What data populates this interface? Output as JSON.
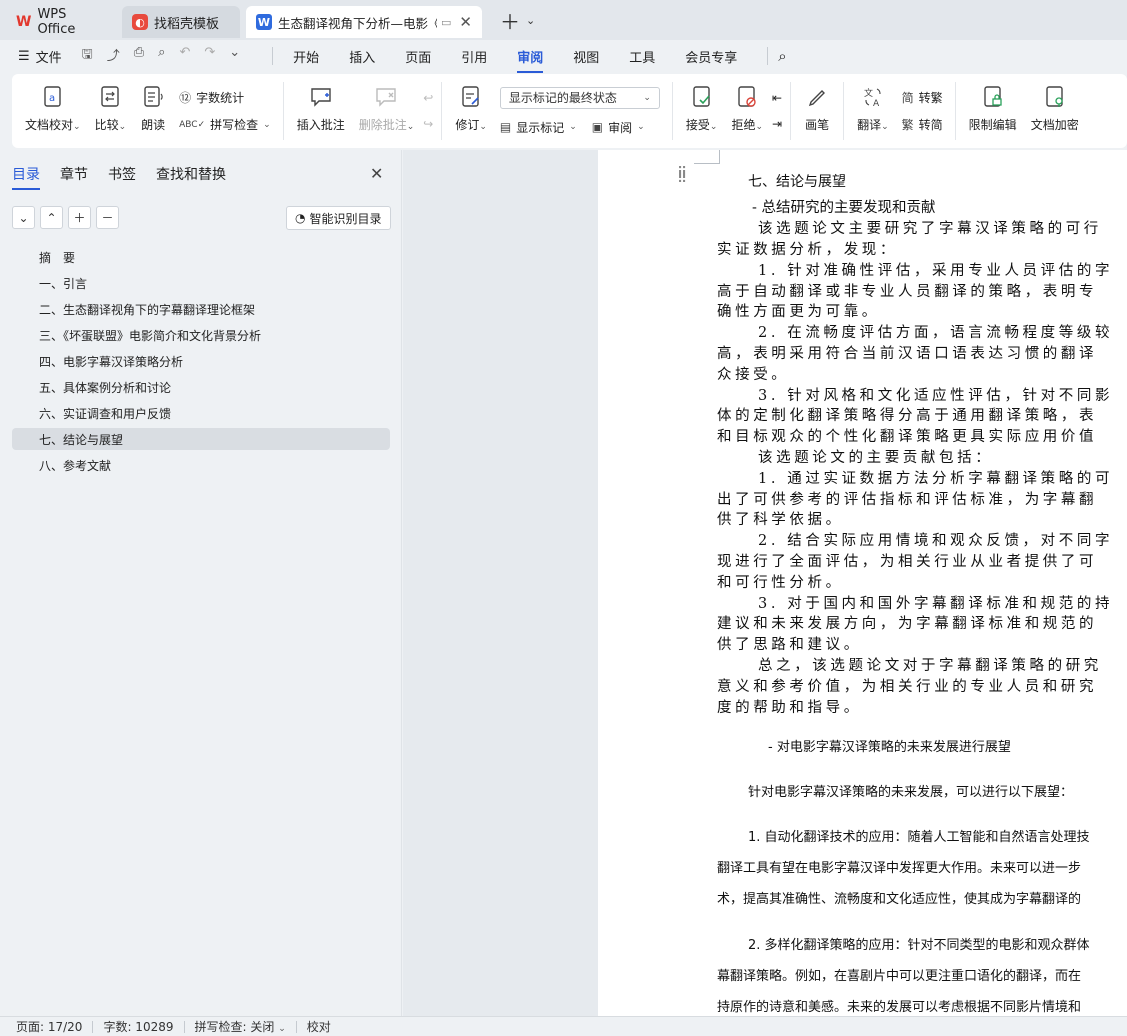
{
  "tabs": {
    "wps_label": "WPS Office",
    "template_label": "找稻壳模板",
    "doc_title": "生态翻译视角下分析—电影《"
  },
  "menubar": {
    "file": "文件",
    "items": [
      "开始",
      "插入",
      "页面",
      "引用",
      "审阅",
      "视图",
      "工具",
      "会员专享"
    ],
    "active": "审阅"
  },
  "ribbon": {
    "proofread": "文档校对",
    "compare": "比较",
    "read_aloud": "朗读",
    "word_count": "字数统计",
    "spell_check": "拼写检查",
    "insert_comment": "插入批注",
    "delete_comment": "删除批注",
    "track": "修订",
    "markup_state": "显示标记的最终状态",
    "show_markup": "显示标记",
    "review": "审阅",
    "accept": "接受",
    "reject": "拒绝",
    "pen": "画笔",
    "translate": "翻译",
    "to_traditional": "转繁",
    "to_simplified": "转简",
    "restrict_edit": "限制编辑",
    "encrypt": "文档加密"
  },
  "panel": {
    "tabs": [
      "目录",
      "章节",
      "书签",
      "查找和替换"
    ],
    "smart_toc": "智能识别目录",
    "toc": [
      "摘　要",
      "一、引言",
      "二、生态翻译视角下的字幕翻译理论框架",
      "三、《坏蛋联盟》电影简介和文化背景分析",
      "四、电影字幕汉译策略分析",
      "五、具体案例分析和讨论",
      "六、实证调查和用户反馈",
      "七、结论与展望",
      "八、参考文献"
    ],
    "selected_index": 7
  },
  "doc": {
    "heading": "七、结论与展望",
    "sub1": "-  总结研究的主要发现和贡献",
    "lines": [
      "该选题论文主要研究了字幕汉译策略的可行",
      "实证数据分析，发现：",
      "1. 针对准确性评估，采用专业人员评估的字",
      "高于自动翻译或非专业人员翻译的策略，表明专",
      "确性方面更为可靠。",
      "2. 在流畅度评估方面，语言流畅程度等级较",
      "高，表明采用符合当前汉语口语表达习惯的翻译",
      "众接受。",
      "3. 针对风格和文化适应性评估，针对不同影",
      "体的定制化翻译策略得分高于通用翻译策略，表",
      "和目标观众的个性化翻译策略更具实际应用价值",
      "该选题论文的主要贡献包括：",
      "1. 通过实证数据方法分析字幕翻译策略的可",
      "出了可供参考的评估指标和评估标准，为字幕翻",
      "供了科学依据。",
      "2. 结合实际应用情境和观众反馈，对不同字",
      "现进行了全面评估，为相关行业从业者提供了可",
      "和可行性分析。",
      "3. 对于国内和国外字幕翻译标准和规范的持",
      "建议和未来发展方向，为字幕翻译标准和规范的",
      "供了思路和建议。",
      "总之，该选题论文对于字幕翻译策略的研究",
      "意义和参考价值，为相关行业的专业人员和研究",
      "度的帮助和指导。"
    ],
    "sub2": "-  对电影字幕汉译策略的未来发展进行展望",
    "p2_intro": "针对电影字幕汉译策略的未来发展，可以进行以下展望：",
    "p2_lines": [
      "1. 自动化翻译技术的应用：随着人工智能和自然语言处理技",
      "翻译工具有望在电影字幕汉译中发挥更大作用。未来可以进一步",
      "术，提高其准确性、流畅度和文化适应性，使其成为字幕翻译的",
      "2. 多样化翻译策略的应用：针对不同类型的电影和观众群体",
      "幕翻译策略。例如，在喜剧片中可以更注重口语化的翻译，而在",
      "持原作的诗意和美感。未来的发展可以考虑根据不同影片情境和"
    ]
  },
  "status": {
    "page": "页面: 17/20",
    "words": "字数: 10289",
    "spell": "拼写检查: 关闭",
    "proof": "校对"
  }
}
